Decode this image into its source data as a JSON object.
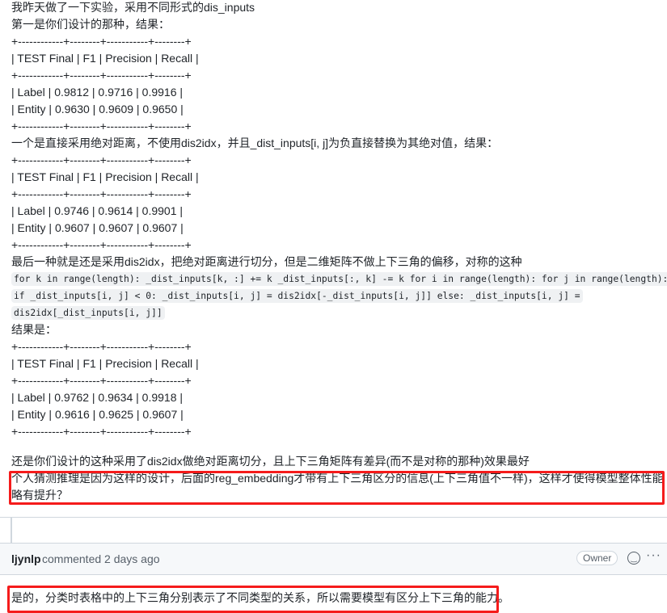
{
  "comment1": {
    "lines": [
      "我昨天做了一下实验，采用不同形式的dis_inputs",
      "第一是你们设计的那种，结果：",
      "+------------+--------+-----------+--------+",
      "| TEST Final | F1 | Precision | Recall |",
      "+------------+--------+-----------+--------+",
      "| Label | 0.9812 | 0.9716 | 0.9916 |",
      "| Entity | 0.9630 | 0.9609 | 0.9650 |",
      "+------------+--------+-----------+--------+",
      "一个是直接采用绝对距离，不使用dis2idx，并且_dist_inputs[i, j]为负直接替换为其绝对值，结果：",
      "+------------+--------+-----------+--------+",
      "| TEST Final | F1 | Precision | Recall |",
      "+------------+--------+-----------+--------+",
      "| Label | 0.9746 | 0.9614 | 0.9901 |",
      "| Entity | 0.9607 | 0.9607 | 0.9607 |",
      "+------------+--------+-----------+--------+",
      "最后一种就是还是采用dis2idx，把绝对距离进行切分，但是二维矩阵不做上下三角的偏移，对称的这种"
    ],
    "code_lines": [
      "for k in range(length): _dist_inputs[k, :] += k _dist_inputs[:, k] -= k for i in range(length): for j in range(length):",
      "if _dist_inputs[i, j] < 0: _dist_inputs[i, j] = dis2idx[-_dist_inputs[i, j]] else: _dist_inputs[i, j] =",
      "dis2idx[_dist_inputs[i, j]]"
    ],
    "lines2": [
      "结果是：",
      "+------------+--------+-----------+--------+",
      "| TEST Final | F1 | Precision | Recall |",
      "+------------+--------+-----------+--------+",
      "| Label | 0.9762 | 0.9634 | 0.9918 |",
      "| Entity | 0.9616 | 0.9625 | 0.9607 |",
      "+------------+--------+-----------+--------+"
    ],
    "conclusion": "还是你们设计的这种采用了dis2idx做绝对距离切分，且上下三角矩阵有差异(而不是对称的那种)效果最好",
    "question_line1": "个人猜测推理是因为这样的设计，后面的reg_embedding才带有上下三角区分的信息(上下三角值不一样)，这样才使得模型整体性能",
    "question_line2": "略有提升？"
  },
  "comment2": {
    "author": "ljynlp",
    "meta": "commented 2 days ago",
    "badge": "Owner",
    "emoji_icon": "smiley-icon",
    "more_icon": "kebab-horizontal-icon",
    "body": "是的，分类时表格中的上下三角分别表示了不同类型的关系，所以需要模型有区分上下三角的能力。"
  },
  "colors": {
    "highlight": "#f51b1b",
    "border": "#d0d7de",
    "header_bg": "#f6f8fa"
  }
}
